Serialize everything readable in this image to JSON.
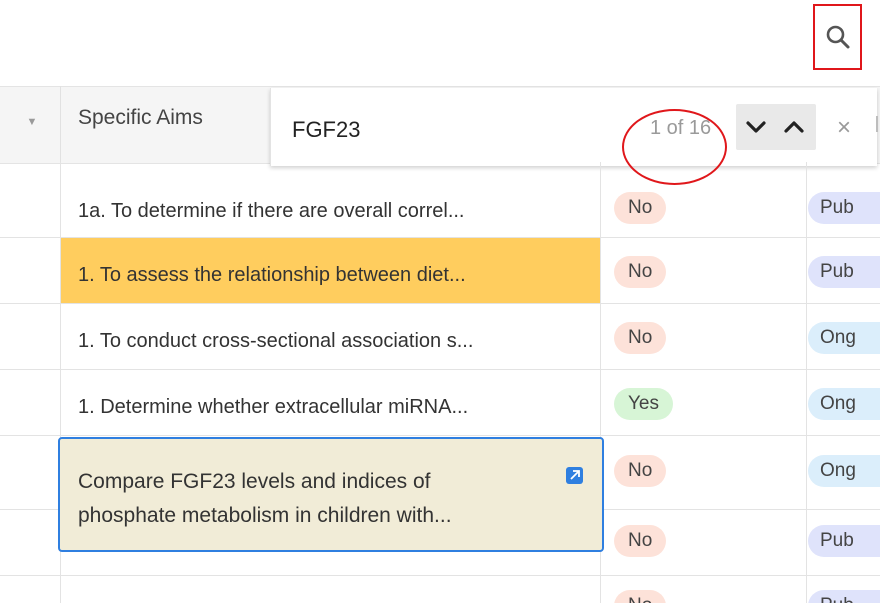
{
  "search_icon_name": "search-icon",
  "header": {
    "column_label": "Specific Aims",
    "sort_icon": "caret-down-icon"
  },
  "search_bar": {
    "query": "FGF23",
    "match_count": "1 of 16",
    "next_icon": "chevron-down-icon",
    "prev_icon": "chevron-up-icon",
    "close_icon": "close-icon"
  },
  "rows": [
    {
      "aim": "1a. To determine if there are overall correl...",
      "flag": "No",
      "status": "Pub"
    },
    {
      "aim": "1. To assess the relationship between diet...",
      "flag": "No",
      "status": "Pub"
    },
    {
      "aim": "1. To conduct cross-sectional association s...",
      "flag": "No",
      "status": "Ong"
    },
    {
      "aim": "1. Determine whether extracellular miRNA...",
      "flag": "Yes",
      "status": "Ong"
    },
    {
      "aim": "Compare FGF23 levels and indices of phosphate metabolism in children with...",
      "flag": "No",
      "status": "Ong"
    },
    {
      "aim": "",
      "flag": "No",
      "status": "Pub"
    },
    {
      "aim": "",
      "flag": "No",
      "status": "Pub"
    }
  ],
  "colors": {
    "highlight": "#ffcd5e",
    "annotation_red": "#e0171b",
    "editor_border": "#2f7fe0",
    "pill_no": "#fde2d9",
    "pill_yes": "#d7f5d6"
  }
}
